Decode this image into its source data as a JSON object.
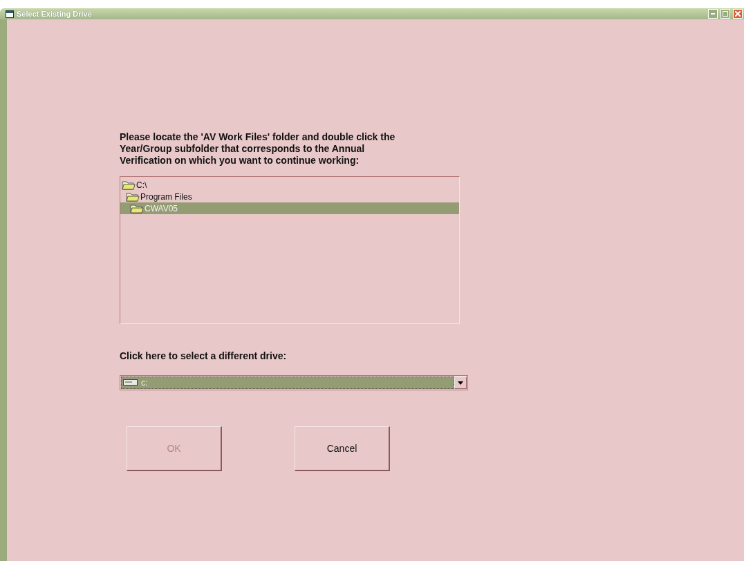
{
  "window": {
    "title": "Select Existing Drive"
  },
  "instructions": "Please locate the 'AV Work Files' folder and double click the Year/Group subfolder that corresponds to the Annual Verification on which you want to continue working:",
  "folders": [
    {
      "label": "C:\\",
      "selected": false,
      "children": [
        {
          "label": "Program Files",
          "selected": false,
          "children": [
            {
              "label": "CWAV05",
              "selected": true
            }
          ]
        }
      ]
    }
  ],
  "drive_label": "Click here to select a different drive:",
  "drive": {
    "value": "c:"
  },
  "buttons": [
    {
      "label": "OK",
      "disabled": true
    },
    {
      "label": "Cancel",
      "disabled": false
    }
  ]
}
